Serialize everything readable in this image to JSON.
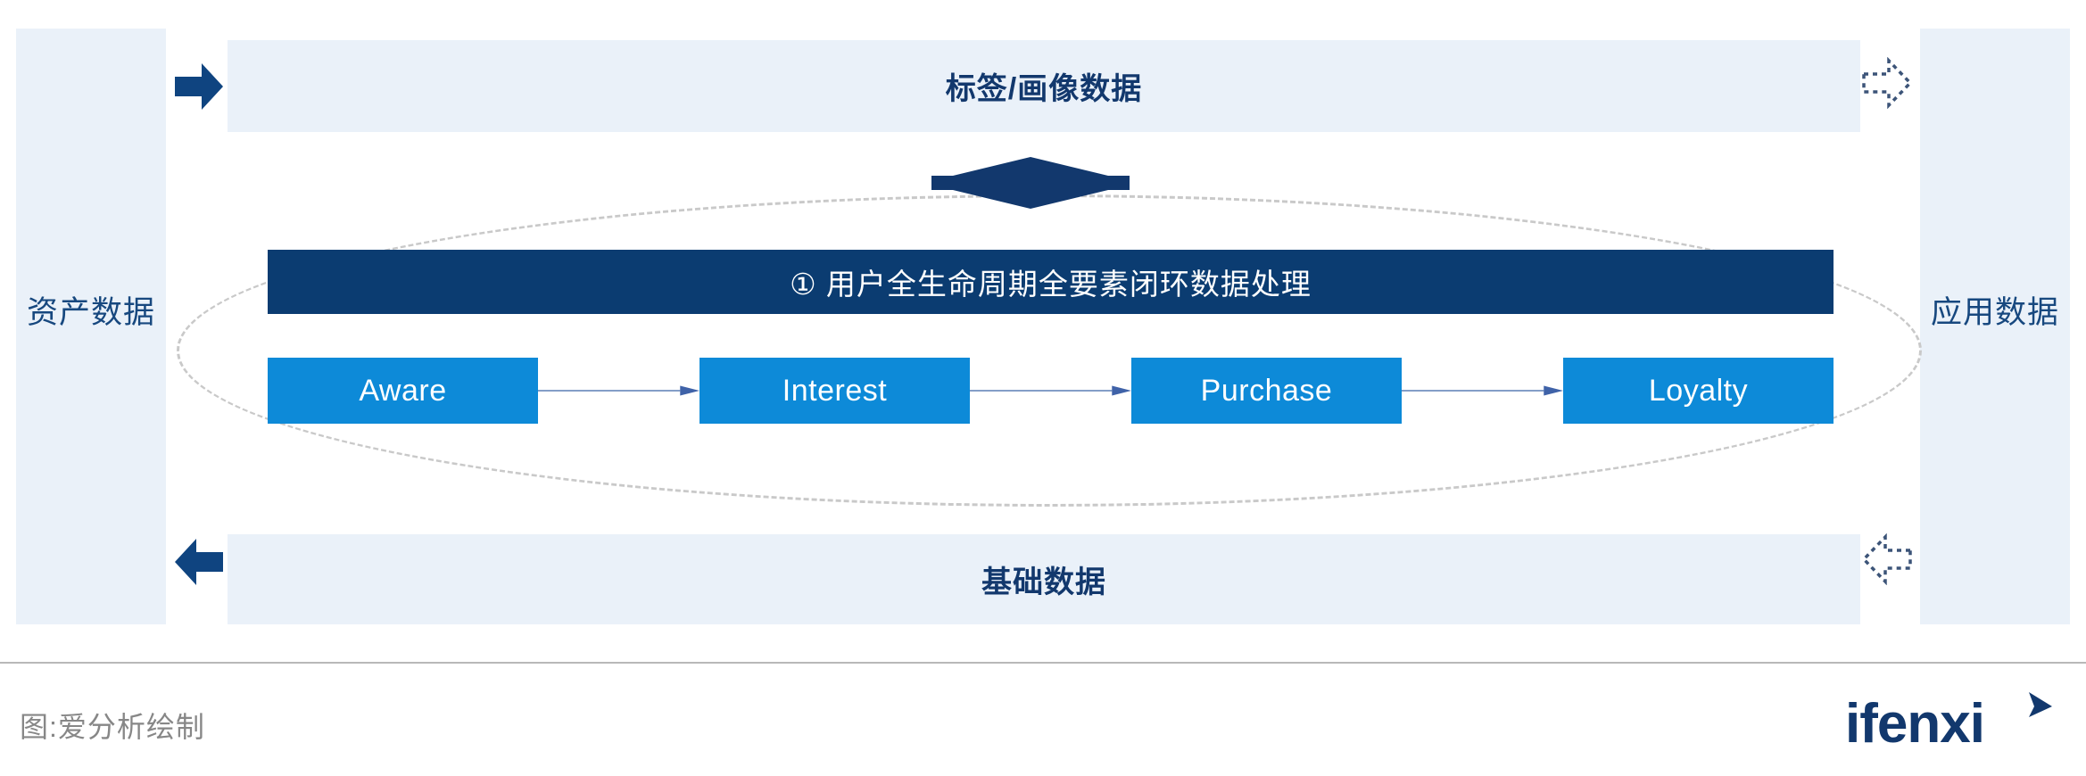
{
  "sidebars": {
    "left": {
      "label": "资产数据"
    },
    "right": {
      "label": "应用数据"
    }
  },
  "banners": {
    "top": {
      "label": "标签/画像数据"
    },
    "bottom": {
      "label": "基础数据"
    }
  },
  "process": {
    "label": "①  用户全生命周期全要素闭环数据处理"
  },
  "stages": [
    {
      "label": "Aware"
    },
    {
      "label": "Interest"
    },
    {
      "label": "Purchase"
    },
    {
      "label": "Loyalty"
    }
  ],
  "arrows": {
    "top_left": "solid-right-arrow-icon",
    "bottom_left": "solid-left-arrow-icon",
    "top_right": "dashed-right-arrow-icon",
    "bottom_right": "dashed-left-arrow-icon",
    "center": "bidirectional-arrow-icon"
  },
  "footer": {
    "caption": "图:爱分析绘制",
    "logo_text": "ifenxi"
  },
  "colors": {
    "panel_bg": "#eaf1f9",
    "navy": "#12386d",
    "navy_dark": "#0b3c71",
    "bright_blue": "#0d8ad8",
    "ellipse_dash": "#c9c9c9",
    "connector": "#5b7fb5",
    "caption_gray": "#878787",
    "divider_gray": "#b8b8b8"
  }
}
